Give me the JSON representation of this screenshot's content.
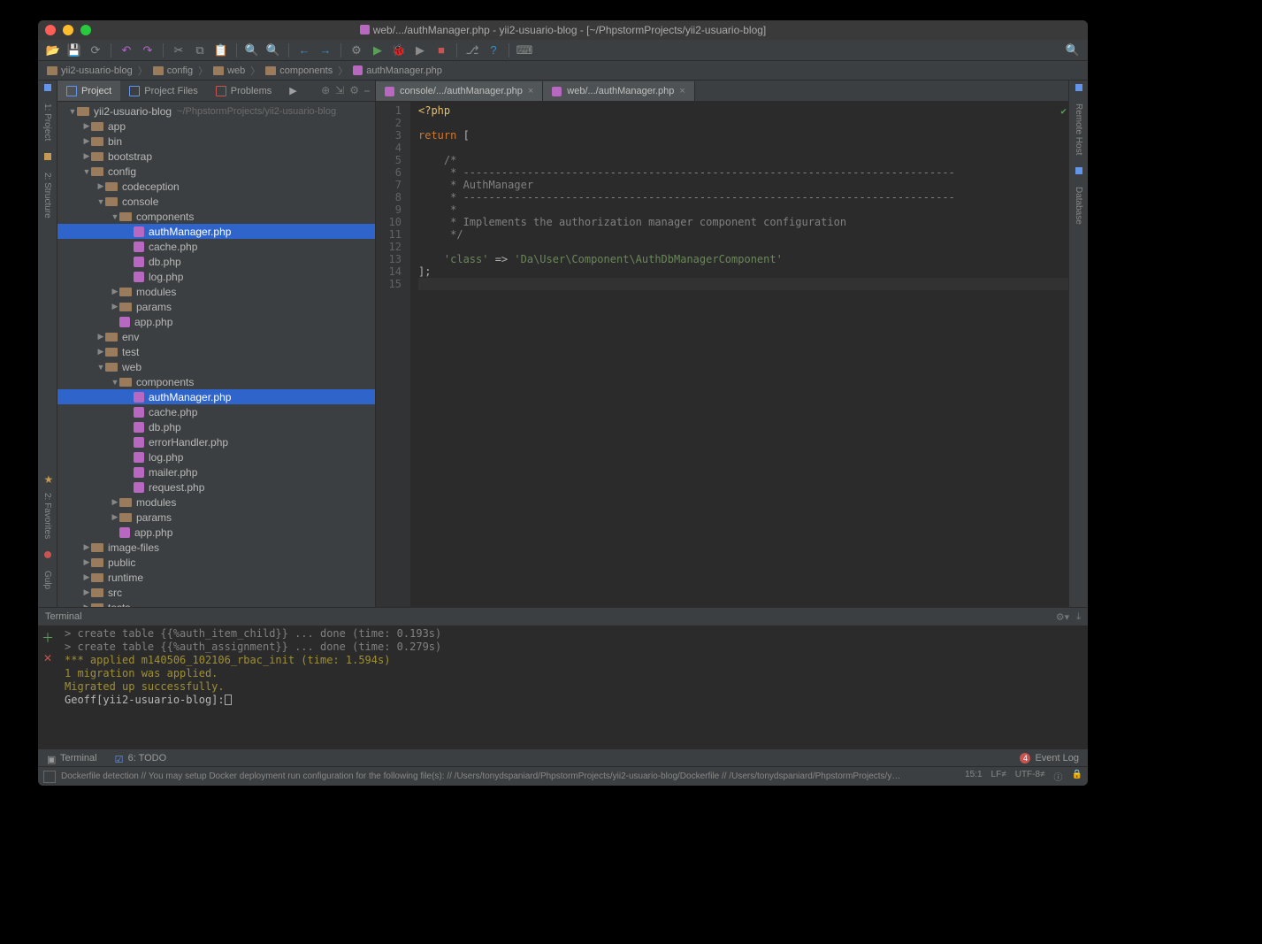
{
  "title": "web/.../authManager.php - yii2-usuario-blog - [~/PhpstormProjects/yii2-usuario-blog]",
  "breadcrumbs": [
    {
      "icon": "folder",
      "label": "yii2-usuario-blog"
    },
    {
      "icon": "folder",
      "label": "config"
    },
    {
      "icon": "folder",
      "label": "web"
    },
    {
      "icon": "folder",
      "label": "components"
    },
    {
      "icon": "php",
      "label": "authManager.php"
    }
  ],
  "leftRail": [
    "1: Project",
    "2: Structure"
  ],
  "leftRailBottom": [
    "2: Favorites",
    "Gulp"
  ],
  "rightRail": [
    "Remote Host",
    "Database"
  ],
  "panelTabs": [
    "Project",
    "Project Files",
    "Problems"
  ],
  "tree": [
    {
      "d": 0,
      "a": "expanded",
      "i": "folder",
      "t": "yii2-usuario-blog",
      "path": "~/PhpstormProjects/yii2-usuario-blog"
    },
    {
      "d": 1,
      "a": "collapsed",
      "i": "folder",
      "t": "app"
    },
    {
      "d": 1,
      "a": "collapsed",
      "i": "folder",
      "t": "bin"
    },
    {
      "d": 1,
      "a": "collapsed",
      "i": "folder",
      "t": "bootstrap"
    },
    {
      "d": 1,
      "a": "expanded",
      "i": "folder",
      "t": "config"
    },
    {
      "d": 2,
      "a": "collapsed",
      "i": "folder",
      "t": "codeception"
    },
    {
      "d": 2,
      "a": "expanded",
      "i": "folder",
      "t": "console"
    },
    {
      "d": 3,
      "a": "expanded",
      "i": "folder",
      "t": "components"
    },
    {
      "d": 4,
      "a": "none",
      "i": "php",
      "t": "authManager.php",
      "sel": true
    },
    {
      "d": 4,
      "a": "none",
      "i": "php",
      "t": "cache.php"
    },
    {
      "d": 4,
      "a": "none",
      "i": "php",
      "t": "db.php"
    },
    {
      "d": 4,
      "a": "none",
      "i": "php",
      "t": "log.php"
    },
    {
      "d": 3,
      "a": "collapsed",
      "i": "folder",
      "t": "modules"
    },
    {
      "d": 3,
      "a": "collapsed",
      "i": "folder",
      "t": "params"
    },
    {
      "d": 3,
      "a": "none",
      "i": "php",
      "t": "app.php"
    },
    {
      "d": 2,
      "a": "collapsed",
      "i": "folder",
      "t": "env"
    },
    {
      "d": 2,
      "a": "collapsed",
      "i": "folder",
      "t": "test"
    },
    {
      "d": 2,
      "a": "expanded",
      "i": "folder",
      "t": "web"
    },
    {
      "d": 3,
      "a": "expanded",
      "i": "folder",
      "t": "components"
    },
    {
      "d": 4,
      "a": "none",
      "i": "php",
      "t": "authManager.php",
      "sel": true
    },
    {
      "d": 4,
      "a": "none",
      "i": "php",
      "t": "cache.php"
    },
    {
      "d": 4,
      "a": "none",
      "i": "php",
      "t": "db.php"
    },
    {
      "d": 4,
      "a": "none",
      "i": "php",
      "t": "errorHandler.php"
    },
    {
      "d": 4,
      "a": "none",
      "i": "php",
      "t": "log.php"
    },
    {
      "d": 4,
      "a": "none",
      "i": "php",
      "t": "mailer.php"
    },
    {
      "d": 4,
      "a": "none",
      "i": "php",
      "t": "request.php"
    },
    {
      "d": 3,
      "a": "collapsed",
      "i": "folder",
      "t": "modules"
    },
    {
      "d": 3,
      "a": "collapsed",
      "i": "folder",
      "t": "params"
    },
    {
      "d": 3,
      "a": "none",
      "i": "php",
      "t": "app.php"
    },
    {
      "d": 1,
      "a": "collapsed",
      "i": "folder",
      "t": "image-files"
    },
    {
      "d": 1,
      "a": "collapsed",
      "i": "folder",
      "t": "public"
    },
    {
      "d": 1,
      "a": "collapsed",
      "i": "folder",
      "t": "runtime"
    },
    {
      "d": 1,
      "a": "collapsed",
      "i": "folder",
      "t": "src"
    },
    {
      "d": 1,
      "a": "collapsed",
      "i": "folder",
      "t": "tests"
    }
  ],
  "editorTabs": [
    {
      "label": "console/.../authManager.php",
      "active": false
    },
    {
      "label": "web/.../authManager.php",
      "active": true
    }
  ],
  "code": {
    "lines": 15,
    "l1_tag": "<?php",
    "l3_kw": "return ",
    "l3_b": "[",
    "l5": "/*",
    "l6": " * -----------------------------------------------------------------------------",
    "l7": " * AuthManager",
    "l8": " * -----------------------------------------------------------------------------",
    "l9": " *",
    "l10": " * Implements the authorization manager component configuration",
    "l11": " */",
    "l13_key": "'class'",
    "l13_arrow": " => ",
    "l13_val": "'Da\\User\\Component\\AuthDbManagerComponent'",
    "l14": "];"
  },
  "terminal": {
    "title": "Terminal",
    "lines": [
      {
        "cls": "g",
        "t": "    > create table {{%auth_item_child}} ... done (time: 0.193s)"
      },
      {
        "cls": "g",
        "t": "    > create table {{%auth_assignment}} ... done (time: 0.279s)"
      },
      {
        "cls": "y",
        "t": "*** applied m140506_102106_rbac_init (time: 1.594s)"
      },
      {
        "cls": "",
        "t": ""
      },
      {
        "cls": "",
        "t": ""
      },
      {
        "cls": "y",
        "t": "1 migration was applied."
      },
      {
        "cls": "",
        "t": ""
      },
      {
        "cls": "y",
        "t": "Migrated up successfully."
      }
    ],
    "prompt": "Geoff[yii2-usuario-blog]:"
  },
  "bottomTabs": {
    "terminal": "Terminal",
    "todo": "6: TODO",
    "eventLog": "Event Log",
    "badge": "4"
  },
  "status": {
    "hint": "Dockerfile detection // You may setup Docker deployment run configuration for the following file(s): // /Users/tonydspaniard/PhpstormProjects/yii2-usuario-blog/Dockerfile // /Users/tonydspaniard/PhpstormProjects/y…",
    "pos": "15:1",
    "lf": "LF≠",
    "enc": "UTF-8≠"
  }
}
